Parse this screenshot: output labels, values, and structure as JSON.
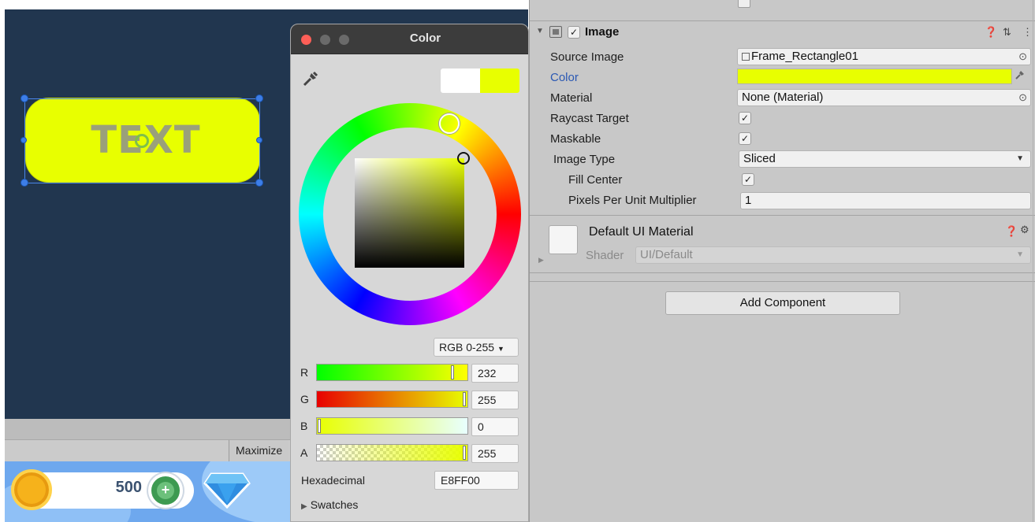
{
  "scene": {
    "button_text": "TEXT",
    "button_color": "#e8ff00",
    "background_color": "#21364f"
  },
  "game_toolbar": {
    "maximize_label": "Maximize"
  },
  "game_hud": {
    "coin_count": "500"
  },
  "color_picker": {
    "title": "Color",
    "mode": "RGB 0-255",
    "current_color": "#e8ff00",
    "previous_color": "#ffffff",
    "channels": [
      {
        "label": "R",
        "value": "232"
      },
      {
        "label": "G",
        "value": "255"
      },
      {
        "label": "B",
        "value": "0"
      },
      {
        "label": "A",
        "value": "255"
      }
    ],
    "hex_label": "Hexadecimal",
    "hex_value": "E8FF00",
    "swatches_label": "Swatches"
  },
  "inspector": {
    "component_title": "Image",
    "properties": {
      "source_image_label": "Source Image",
      "source_image_value": "Frame_Rectangle01",
      "color_label": "Color",
      "material_label": "Material",
      "material_value": "None (Material)",
      "raycast_label": "Raycast Target",
      "maskable_label": "Maskable",
      "image_type_label": "Image Type",
      "image_type_value": "Sliced",
      "fill_center_label": "Fill Center",
      "ppu_label": "Pixels Per Unit Multiplier",
      "ppu_value": "1"
    },
    "material_section": {
      "name": "Default UI Material",
      "shader_label": "Shader",
      "shader_value": "UI/Default"
    },
    "add_component_label": "Add Component"
  }
}
